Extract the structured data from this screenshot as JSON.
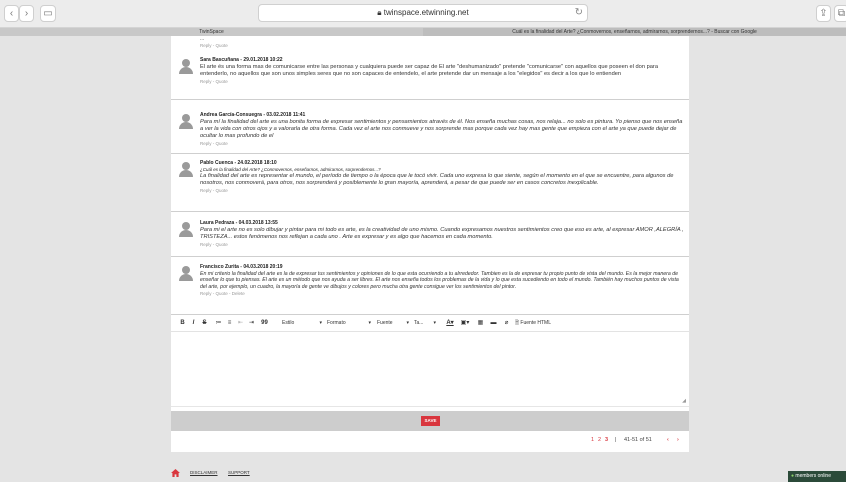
{
  "browser": {
    "address": "twinspace.etwinning.net",
    "tabs": [
      "TwinSpace",
      "Cuál es la finalidad del Arte? ¿Conmovernos, enseñarnos, admirarnos, sorprendernos...? - Buscar con Google"
    ]
  },
  "top_fragment": "...",
  "comments": [
    {
      "author": "Sara Bascuñana - 29.01.2018 10:22",
      "question": "",
      "text": "El arte és una forma mas de comunicarse entre las personas y cualquiera puede ser capaz de El arte \"deshumanizado\" pretende \"comunicarse\" con aquellos que poseen el don para entenderlo, no aquellos que son unos simples seres que no son capaces de entendelo, el arte pretende dar un mensaje a los \"elegidos\" es decir a los que lo entienden",
      "italic": false,
      "actions": "Reply - Quote"
    },
    {
      "author": "Andrea García-Consuegra - 03.02.2018 11:41",
      "question": "",
      "text": "Para mí la finalidad del arte es una bonita forma de expresar sentimientos y pensamientos através de él. Nos enseña muchas cosas, nos relaja... no solo es pintura. Yo pienso que nos enseña a ver la vida con otros ojos y a valorarla de otra forma. Cada vez el arte nos conmueve y nos sorprende mas porque cada vez hay mas gente que empieza con el arte ya que puede dejar de ocultar lo mas profundo de el",
      "italic": true,
      "actions": "Reply - Quote"
    },
    {
      "author": "Pablo Cuenca - 24.02.2018 18:10",
      "question": "¿Cuál es la finalidad del Arte? ¿Conmovernos, enseñarnos, admirarnos, sorprendernos...?",
      "text": "La finalidad del arte es representar el mundo, el período de tiempo o la época que le tocó vivir. Cada uno expresa lo que siente, según el momento en el que se encuentre, para algunos de nosotros, nos conmoverá, para otros, nos sorprenderá y posiblemente lo gran mayoría, aprenderá, a pesar de que puede ser en casos concretos inexplicable.",
      "italic": true,
      "actions": "Reply - Quote"
    },
    {
      "author": "Laura Pedraza - 04.03.2018 13:55",
      "question": "",
      "text": "Para mi el arte no es solo dibujar y pintar para mi todo es arte, es la creatividad de uno mismo. Cuando expresamos nuestros sentimientos creo que eso es arte, al expresar AMOR ,ALEGRÍA , TRISTEZA... estos fenómenos nos reflejan a cada uno . Arte es expresar y es algo que hacemos en cada momento.",
      "italic": true,
      "actions": "Reply - Quote"
    },
    {
      "author": "Francisco Zurita - 04.03.2018 20:19",
      "question": "",
      "text": "En mi criterio la finalidad del arte es la de expresar tus sentimientos y opiniones de lo que esta ocurriendo a tu alrrededor. Tambien es la de expresar tu propio punto de vista del mundo. Es la mejor manera de enseñar lo que tu piensas. El arte es un método que nos ayuda a ser libres. El arte nos enseña todos los problemas de la vida y lo que esta sucediendo en todo el mundo. También hay muchos puntos de vista del arte, por ejemplo, un cuadro, la mayoría de gente ve dibujos y colores pero mucha otra gente consigue ver los sentimientos del pintor.",
      "italic": true,
      "actions": "Reply - Quote - Delete"
    }
  ],
  "editor": {
    "buttons": [
      "B",
      "I",
      "S",
      "≔",
      "≡",
      "⇤",
      "⇥",
      "99"
    ],
    "selects": [
      "Estilo",
      "Formato",
      "Fuente",
      "Ta..."
    ],
    "source_label": "Fuente HTML"
  },
  "save_label": "SAVE",
  "pagination": {
    "pages": [
      "1",
      "2",
      "3"
    ],
    "range": "41-51 of 51"
  },
  "footer": {
    "links": [
      "DISCLAIMER",
      "SUPPORT"
    ]
  },
  "online": "members online",
  "colors": {
    "accent": "#d9363e",
    "online_bg": "#2b4a39"
  }
}
